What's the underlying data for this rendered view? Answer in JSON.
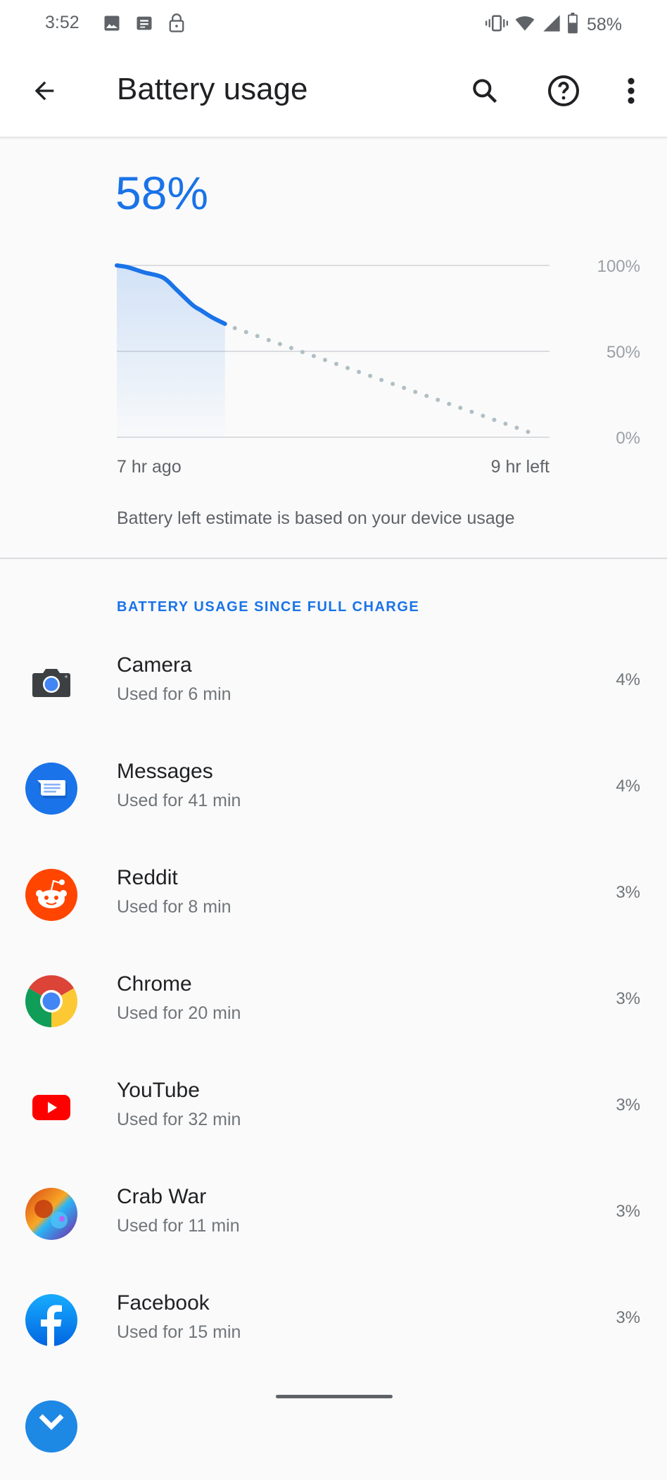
{
  "status_bar": {
    "time": "3:52",
    "left_icons": [
      "image-icon",
      "news-icon",
      "lock-icon"
    ],
    "right_icons": [
      "vibrate-icon",
      "wifi-icon",
      "signal-icon",
      "battery-icon"
    ],
    "battery_percent": "58%"
  },
  "toolbar": {
    "title": "Battery usage",
    "back_icon": "arrow-back-icon",
    "actions": [
      "search-icon",
      "help-icon",
      "more-vert-icon"
    ]
  },
  "battery": {
    "level": "58%",
    "subtitle": "Battery left estimate is based on your device usage"
  },
  "chart_data": {
    "type": "line",
    "title": "",
    "xlabel": "",
    "ylabel": "",
    "ylim": [
      0,
      100
    ],
    "yticks": [
      "100%",
      "50%",
      "0%"
    ],
    "x_start_label": "7 hr ago",
    "x_end_label": "9 hr left",
    "xlim_hours": [
      -7,
      9
    ],
    "grid": true,
    "series": [
      {
        "name": "Battery history",
        "style": "solid-filled",
        "color": "#1a73e8",
        "x": [
          -7.0,
          -6.6,
          -6.0,
          -5.3,
          -4.8,
          -4.2,
          -3.9,
          -3.5,
          -3.0
        ],
        "y": [
          100,
          99,
          96,
          93,
          86,
          77,
          74,
          70,
          66
        ]
      },
      {
        "name": "Predicted",
        "style": "dotted",
        "color": "#b0bec5",
        "x": [
          -3.0,
          8.6
        ],
        "y": [
          66,
          1
        ]
      }
    ]
  },
  "section_header": "BATTERY USAGE SINCE FULL CHARGE",
  "apps": [
    {
      "name": "Camera",
      "usage": "Used for 6 min",
      "percent": "4%",
      "icon": "camera-icon"
    },
    {
      "name": "Messages",
      "usage": "Used for 41 min",
      "percent": "4%",
      "icon": "messages-icon"
    },
    {
      "name": "Reddit",
      "usage": "Used for 8 min",
      "percent": "3%",
      "icon": "reddit-icon"
    },
    {
      "name": "Chrome",
      "usage": "Used for 20 min",
      "percent": "3%",
      "icon": "chrome-icon"
    },
    {
      "name": "YouTube",
      "usage": "Used for 32 min",
      "percent": "3%",
      "icon": "youtube-icon"
    },
    {
      "name": "Crab War",
      "usage": "Used for 11 min",
      "percent": "3%",
      "icon": "crab-war-icon"
    },
    {
      "name": "Facebook",
      "usage": "Used for 15 min",
      "percent": "3%",
      "icon": "facebook-icon"
    }
  ],
  "colors": {
    "accent": "#1a73e8",
    "prediction": "#b0bec5"
  }
}
